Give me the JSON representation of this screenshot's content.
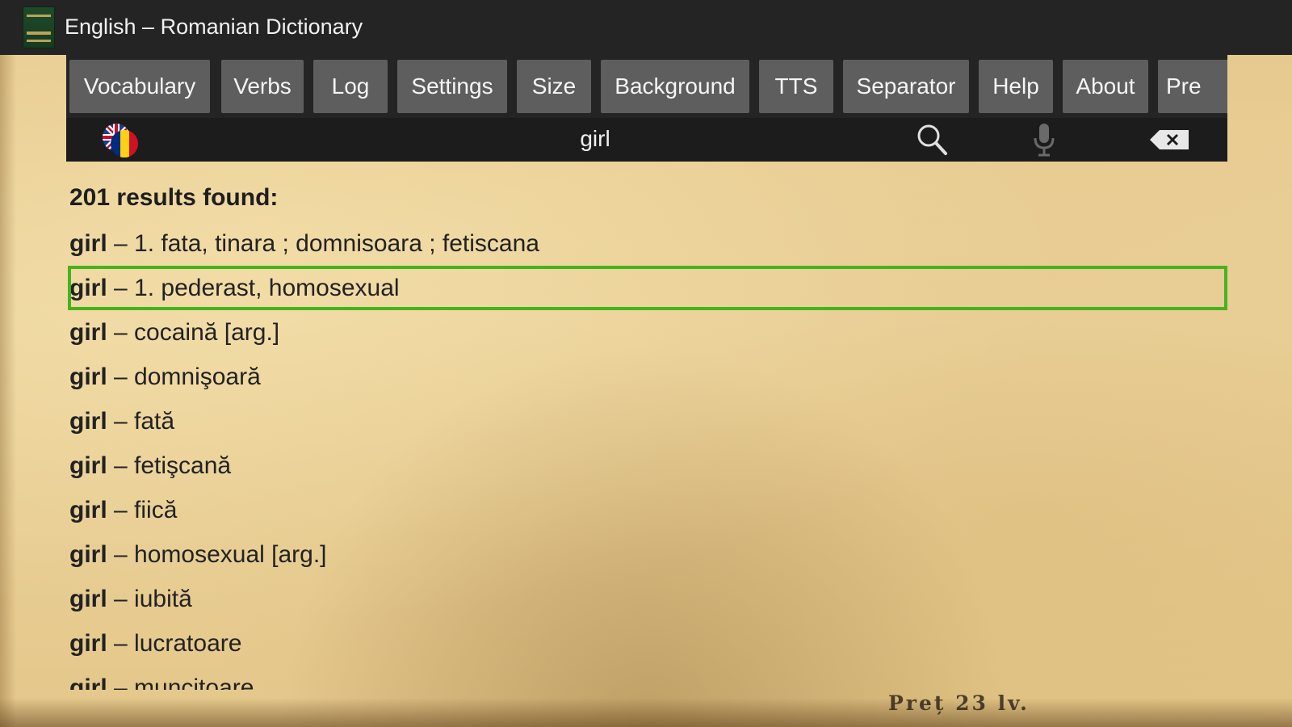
{
  "window": {
    "title": "English – Romanian Dictionary",
    "app_icon": "book-icon"
  },
  "menu": {
    "items": [
      {
        "label": "Vocabulary"
      },
      {
        "label": "Verbs"
      },
      {
        "label": "Log"
      },
      {
        "label": "Settings"
      },
      {
        "label": "Size"
      },
      {
        "label": "Background"
      },
      {
        "label": "TTS"
      },
      {
        "label": "Separator"
      },
      {
        "label": "Help"
      },
      {
        "label": "About"
      },
      {
        "label": "Pre"
      }
    ]
  },
  "search": {
    "language_flag": "uk-romania-flag-icon",
    "query": "girl",
    "icons": [
      "search-icon",
      "microphone-icon",
      "clear-icon"
    ]
  },
  "results": {
    "count_text": "201 results found:",
    "selected_index": 1,
    "items": [
      {
        "word": "girl",
        "sep": " – ",
        "definition": "1. fata, tinara ; domnisoara ; fetiscana"
      },
      {
        "word": "girl",
        "sep": " – ",
        "definition": "1. pederast, homosexual"
      },
      {
        "word": "girl",
        "sep": " – ",
        "definition": "cocaină [arg.]"
      },
      {
        "word": "girl",
        "sep": " – ",
        "definition": "domnişoară"
      },
      {
        "word": "girl",
        "sep": " – ",
        "definition": "fată"
      },
      {
        "word": "girl",
        "sep": " – ",
        "definition": "fetişcană"
      },
      {
        "word": "girl",
        "sep": " – ",
        "definition": "fiică"
      },
      {
        "word": "girl",
        "sep": " – ",
        "definition": "homosexual [arg.]"
      },
      {
        "word": "girl",
        "sep": " – ",
        "definition": "iubită"
      },
      {
        "word": "girl",
        "sep": " – ",
        "definition": "lucratoare"
      },
      {
        "word": "girl",
        "sep": " – ",
        "definition": "muncitoare"
      }
    ]
  },
  "background_stamp": "Preț 23 lv.",
  "colors": {
    "selection_outline": "#47b21f",
    "toolbar_bg": "#242424",
    "button_bg": "#5e5e5e"
  }
}
